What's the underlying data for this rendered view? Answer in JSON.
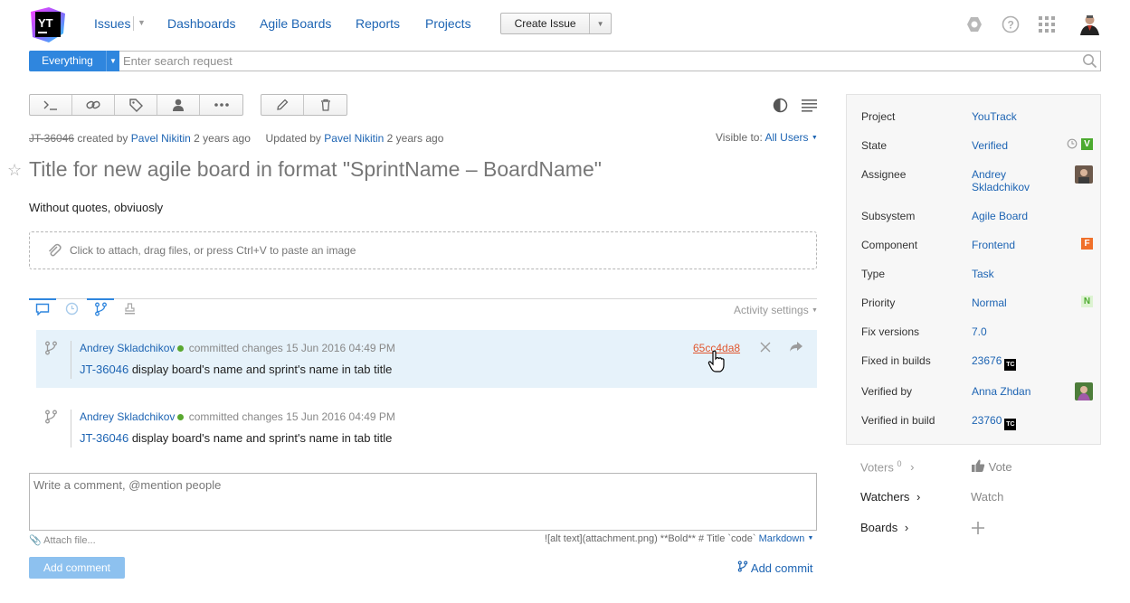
{
  "header": {
    "logo_text": "YT",
    "nav": [
      "Issues",
      "Dashboards",
      "Agile Boards",
      "Reports",
      "Projects"
    ],
    "create_issue_label": "Create Issue"
  },
  "search": {
    "scope_label": "Everything",
    "placeholder": "Enter search request"
  },
  "issue": {
    "id": "JT-36046",
    "created_prefix": "created by",
    "created_by": "Pavel Nikitin",
    "created_when": "2 years ago",
    "updated_prefix": "Updated by",
    "updated_by": "Pavel Nikitin",
    "updated_when": "2 years ago",
    "visible_to_label": "Visible to:",
    "visible_to_value": "All Users",
    "title": "Title for new agile board in format \"SprintName – BoardName\"",
    "description": "Without quotes, obviuosly",
    "attach_hint": "Click to attach, drag files, or press Ctrl+V to paste an image"
  },
  "activity": {
    "settings_label": "Activity settings",
    "commits": [
      {
        "author": "Andrey Skladchikov",
        "action": "committed changes",
        "date": "15 Jun 2016 04:49 PM",
        "hash": "65cc4da8",
        "issue_ref": "JT-36046",
        "message": "display board's name and sprint's name in tab title"
      },
      {
        "author": "Andrey Skladchikov",
        "action": "committed changes",
        "date": "15 Jun 2016 04:49 PM",
        "issue_ref": "JT-36046",
        "message": "display board's name and sprint's name in tab title"
      }
    ]
  },
  "comment": {
    "placeholder": "Write a comment, @mention people",
    "attach_file": "Attach file...",
    "markdown_hint": "![alt text](attachment.png) **Bold** # Title `code`",
    "markdown_label": "Markdown",
    "add_comment_label": "Add comment",
    "add_commit_label": "Add commit"
  },
  "fields": [
    {
      "name": "Project",
      "value": "YouTrack"
    },
    {
      "name": "State",
      "value": "Verified",
      "badge": "V",
      "badge_color": "#4caa2f"
    },
    {
      "name": "Assignee",
      "value": "Andrey Skladchikov"
    },
    {
      "name": "Subsystem",
      "value": "Agile Board"
    },
    {
      "name": "Component",
      "value": "Frontend",
      "badge": "F",
      "badge_color": "#f0702a"
    },
    {
      "name": "Type",
      "value": "Task"
    },
    {
      "name": "Priority",
      "value": "Normal",
      "badge": "N",
      "badge_color": "#ddf3d2"
    },
    {
      "name": "Fix versions",
      "value": "7.0"
    },
    {
      "name": "Fixed in builds",
      "value": "23676",
      "tc": "TC"
    },
    {
      "name": "Verified by",
      "value": "Anna Zhdan"
    },
    {
      "name": "Verified in build",
      "value": "23760",
      "tc": "TC"
    }
  ],
  "sidebar": {
    "voters_label": "Voters",
    "voters_count": "0",
    "vote_label": "Vote",
    "watchers_label": "Watchers",
    "watch_label": "Watch",
    "boards_label": "Boards"
  }
}
